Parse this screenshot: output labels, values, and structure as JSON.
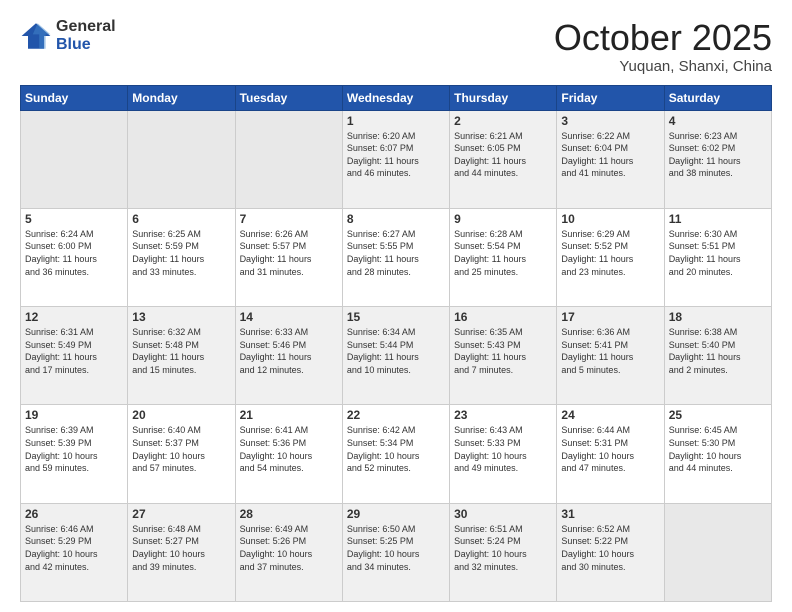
{
  "logo": {
    "general": "General",
    "blue": "Blue"
  },
  "header": {
    "month": "October 2025",
    "location": "Yuquan, Shanxi, China"
  },
  "weekdays": [
    "Sunday",
    "Monday",
    "Tuesday",
    "Wednesday",
    "Thursday",
    "Friday",
    "Saturday"
  ],
  "weeks": [
    [
      {
        "day": "",
        "info": ""
      },
      {
        "day": "",
        "info": ""
      },
      {
        "day": "",
        "info": ""
      },
      {
        "day": "1",
        "info": "Sunrise: 6:20 AM\nSunset: 6:07 PM\nDaylight: 11 hours\nand 46 minutes."
      },
      {
        "day": "2",
        "info": "Sunrise: 6:21 AM\nSunset: 6:05 PM\nDaylight: 11 hours\nand 44 minutes."
      },
      {
        "day": "3",
        "info": "Sunrise: 6:22 AM\nSunset: 6:04 PM\nDaylight: 11 hours\nand 41 minutes."
      },
      {
        "day": "4",
        "info": "Sunrise: 6:23 AM\nSunset: 6:02 PM\nDaylight: 11 hours\nand 38 minutes."
      }
    ],
    [
      {
        "day": "5",
        "info": "Sunrise: 6:24 AM\nSunset: 6:00 PM\nDaylight: 11 hours\nand 36 minutes."
      },
      {
        "day": "6",
        "info": "Sunrise: 6:25 AM\nSunset: 5:59 PM\nDaylight: 11 hours\nand 33 minutes."
      },
      {
        "day": "7",
        "info": "Sunrise: 6:26 AM\nSunset: 5:57 PM\nDaylight: 11 hours\nand 31 minutes."
      },
      {
        "day": "8",
        "info": "Sunrise: 6:27 AM\nSunset: 5:55 PM\nDaylight: 11 hours\nand 28 minutes."
      },
      {
        "day": "9",
        "info": "Sunrise: 6:28 AM\nSunset: 5:54 PM\nDaylight: 11 hours\nand 25 minutes."
      },
      {
        "day": "10",
        "info": "Sunrise: 6:29 AM\nSunset: 5:52 PM\nDaylight: 11 hours\nand 23 minutes."
      },
      {
        "day": "11",
        "info": "Sunrise: 6:30 AM\nSunset: 5:51 PM\nDaylight: 11 hours\nand 20 minutes."
      }
    ],
    [
      {
        "day": "12",
        "info": "Sunrise: 6:31 AM\nSunset: 5:49 PM\nDaylight: 11 hours\nand 17 minutes."
      },
      {
        "day": "13",
        "info": "Sunrise: 6:32 AM\nSunset: 5:48 PM\nDaylight: 11 hours\nand 15 minutes."
      },
      {
        "day": "14",
        "info": "Sunrise: 6:33 AM\nSunset: 5:46 PM\nDaylight: 11 hours\nand 12 minutes."
      },
      {
        "day": "15",
        "info": "Sunrise: 6:34 AM\nSunset: 5:44 PM\nDaylight: 11 hours\nand 10 minutes."
      },
      {
        "day": "16",
        "info": "Sunrise: 6:35 AM\nSunset: 5:43 PM\nDaylight: 11 hours\nand 7 minutes."
      },
      {
        "day": "17",
        "info": "Sunrise: 6:36 AM\nSunset: 5:41 PM\nDaylight: 11 hours\nand 5 minutes."
      },
      {
        "day": "18",
        "info": "Sunrise: 6:38 AM\nSunset: 5:40 PM\nDaylight: 11 hours\nand 2 minutes."
      }
    ],
    [
      {
        "day": "19",
        "info": "Sunrise: 6:39 AM\nSunset: 5:39 PM\nDaylight: 10 hours\nand 59 minutes."
      },
      {
        "day": "20",
        "info": "Sunrise: 6:40 AM\nSunset: 5:37 PM\nDaylight: 10 hours\nand 57 minutes."
      },
      {
        "day": "21",
        "info": "Sunrise: 6:41 AM\nSunset: 5:36 PM\nDaylight: 10 hours\nand 54 minutes."
      },
      {
        "day": "22",
        "info": "Sunrise: 6:42 AM\nSunset: 5:34 PM\nDaylight: 10 hours\nand 52 minutes."
      },
      {
        "day": "23",
        "info": "Sunrise: 6:43 AM\nSunset: 5:33 PM\nDaylight: 10 hours\nand 49 minutes."
      },
      {
        "day": "24",
        "info": "Sunrise: 6:44 AM\nSunset: 5:31 PM\nDaylight: 10 hours\nand 47 minutes."
      },
      {
        "day": "25",
        "info": "Sunrise: 6:45 AM\nSunset: 5:30 PM\nDaylight: 10 hours\nand 44 minutes."
      }
    ],
    [
      {
        "day": "26",
        "info": "Sunrise: 6:46 AM\nSunset: 5:29 PM\nDaylight: 10 hours\nand 42 minutes."
      },
      {
        "day": "27",
        "info": "Sunrise: 6:48 AM\nSunset: 5:27 PM\nDaylight: 10 hours\nand 39 minutes."
      },
      {
        "day": "28",
        "info": "Sunrise: 6:49 AM\nSunset: 5:26 PM\nDaylight: 10 hours\nand 37 minutes."
      },
      {
        "day": "29",
        "info": "Sunrise: 6:50 AM\nSunset: 5:25 PM\nDaylight: 10 hours\nand 34 minutes."
      },
      {
        "day": "30",
        "info": "Sunrise: 6:51 AM\nSunset: 5:24 PM\nDaylight: 10 hours\nand 32 minutes."
      },
      {
        "day": "31",
        "info": "Sunrise: 6:52 AM\nSunset: 5:22 PM\nDaylight: 10 hours\nand 30 minutes."
      },
      {
        "day": "",
        "info": ""
      }
    ]
  ]
}
